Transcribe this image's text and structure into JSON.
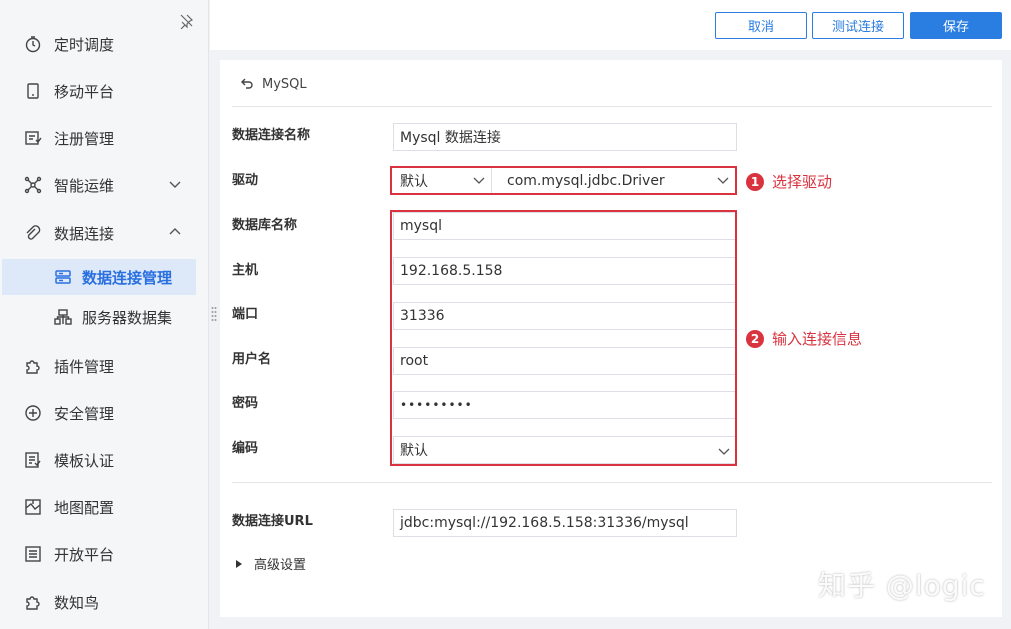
{
  "sidebar": {
    "items": [
      {
        "label": "定时调度",
        "icon": "clock-icon"
      },
      {
        "label": "移动平台",
        "icon": "mobile-icon"
      },
      {
        "label": "注册管理",
        "icon": "register-icon"
      },
      {
        "label": "智能运维",
        "icon": "network-icon",
        "expanded": false
      },
      {
        "label": "数据连接",
        "icon": "link-icon",
        "expanded": true
      },
      {
        "label": "插件管理",
        "icon": "puzzle-icon"
      },
      {
        "label": "安全管理",
        "icon": "shield-icon"
      },
      {
        "label": "模板认证",
        "icon": "template-icon"
      },
      {
        "label": "地图配置",
        "icon": "map-icon"
      },
      {
        "label": "开放平台",
        "icon": "list-icon"
      },
      {
        "label": "数知鸟",
        "icon": "bird-icon"
      }
    ],
    "sub_items": [
      {
        "label": "数据连接管理",
        "icon": "data-connection-icon",
        "active": true
      },
      {
        "label": "服务器数据集",
        "icon": "server-dataset-icon",
        "active": false
      }
    ]
  },
  "toolbar": {
    "cancel_label": "取消",
    "test_label": "测试连接",
    "save_label": "保存"
  },
  "form": {
    "back_label": "MySQL",
    "name_label": "数据连接名称",
    "name_value": "Mysql 数据连接",
    "driver_label": "驱动",
    "driver_mode": "默认",
    "driver_class": "com.mysql.jdbc.Driver",
    "db_label": "数据库名称",
    "db_value": "mysql",
    "host_label": "主机",
    "host_value": "192.168.5.158",
    "port_label": "端口",
    "port_value": "31336",
    "user_label": "用户名",
    "user_value": "root",
    "password_label": "密码",
    "password_value": "•••••••••",
    "encoding_label": "编码",
    "encoding_value": "默认",
    "url_label": "数据连接URL",
    "url_value": "jdbc:mysql://192.168.5.158:31336/mysql",
    "advanced_label": "高级设置"
  },
  "annotations": {
    "a1_num": "1",
    "a1_text": "选择驱动",
    "a2_num": "2",
    "a2_text": "输入连接信息"
  },
  "watermark": "知乎 @logic",
  "colors": {
    "accent": "#2a7de1",
    "annotation_red": "#d9333f",
    "active_bg": "#dde9f8"
  }
}
